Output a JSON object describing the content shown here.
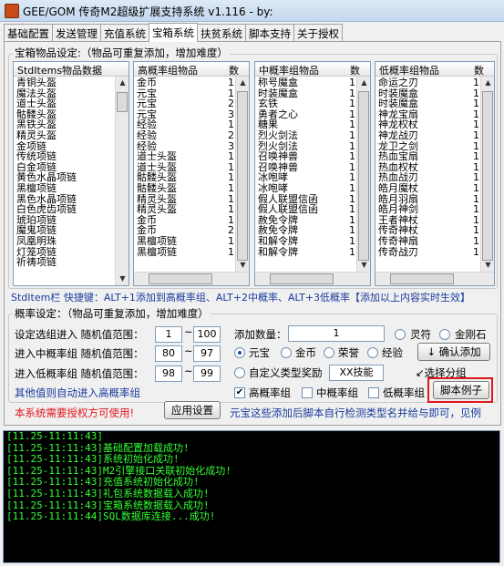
{
  "window": {
    "title": "GEE/GOM 传奇M2超级扩展支持系统 v1.116 - by:"
  },
  "tabs": [
    "基础配置",
    "发送管理",
    "充值系统",
    "宝箱系统",
    "扶贫系统",
    "脚本支持",
    "关于授权"
  ],
  "active_tab": "宝箱系统",
  "chest_group": {
    "title": "宝箱物品设定:（物品可重复添加，增加难度）"
  },
  "stditems": {
    "header": "StdItems物品数据",
    "rows": [
      "青铜头盔",
      "魔法头盔",
      "道士头盔",
      "骷髅头盔",
      "黑铁头盔",
      "精灵头盔",
      "金项链",
      "传统项链",
      "白金项链",
      "黄色水晶项链",
      "黑檀项链",
      "黑色水晶项链",
      "白色虎齿项链",
      "琥珀项链",
      "魔鬼项链",
      "凤凰明珠",
      "灯笼项链",
      "祈祷项链"
    ]
  },
  "high_list": {
    "header": "高概率组物品",
    "header2": "数",
    "rows": [
      [
        "金币",
        "1"
      ],
      [
        "元宝",
        "1"
      ],
      [
        "元宝",
        "2"
      ],
      [
        "元宝",
        "3"
      ],
      [
        "经验",
        "1"
      ],
      [
        "经验",
        "2"
      ],
      [
        "经验",
        "3"
      ],
      [
        "道士头盔",
        "1"
      ],
      [
        "道士头盔",
        "1"
      ],
      [
        "骷髅头盔",
        "1"
      ],
      [
        "骷髅头盔",
        "1"
      ],
      [
        "精灵头盔",
        "1"
      ],
      [
        "精灵头盔",
        "1"
      ],
      [
        "金币",
        "1"
      ],
      [
        "金币",
        "2"
      ],
      [
        "黑檀项链",
        "1"
      ],
      [
        "黑檀项链",
        "1"
      ]
    ]
  },
  "mid_list": {
    "header": "中概率组物品",
    "header2": "数",
    "rows": [
      [
        "称号魔盒",
        "1"
      ],
      [
        "时装魔盒",
        "1"
      ],
      [
        "玄铁",
        "1"
      ],
      [
        "勇者之心",
        "1"
      ],
      [
        "糖果",
        "1"
      ],
      [
        "烈火剑法",
        "1"
      ],
      [
        "烈火剑法",
        "1"
      ],
      [
        "召唤神兽",
        "1"
      ],
      [
        "召唤神兽",
        "1"
      ],
      [
        "冰咆哮",
        "1"
      ],
      [
        "冰咆哮",
        "1"
      ],
      [
        "假人联盟信函",
        "1"
      ],
      [
        "假人联盟信函",
        "1"
      ],
      [
        "赦免令牌",
        "1"
      ],
      [
        "赦免令牌",
        "1"
      ],
      [
        "和解令牌",
        "1"
      ],
      [
        "和解令牌",
        "1"
      ]
    ]
  },
  "low_list": {
    "header": "低概率组物品",
    "header2": "数",
    "rows": [
      [
        "命运之刃",
        "1"
      ],
      [
        "时装魔盒",
        "1"
      ],
      [
        "时装魔盒",
        "1"
      ],
      [
        "神龙宝扇",
        "1"
      ],
      [
        "神龙权杖",
        "1"
      ],
      [
        "神龙战刃",
        "1"
      ],
      [
        "龙卫之剑",
        "1"
      ],
      [
        "热血宝扇",
        "1"
      ],
      [
        "热血权杖",
        "1"
      ],
      [
        "热血战刃",
        "1"
      ],
      [
        "皓月魔杖",
        "1"
      ],
      [
        "皓月羽扇",
        "1"
      ],
      [
        "皓月神剑",
        "1"
      ],
      [
        "王者神杖",
        "1"
      ],
      [
        "传奇神杖",
        "1"
      ],
      [
        "传奇神扇",
        "1"
      ],
      [
        "传奇战刃",
        "1"
      ]
    ]
  },
  "hint": "StdItem栏 快捷键：ALT+1添加到高概率组、ALT+2中概率、ALT+3低概率【添加以上内容实时生效】",
  "prob_group": {
    "title": "概率设定：（物品可重复添加，增加难度）",
    "high_label": "设定选组进入  随机值范围：",
    "high_from": "1",
    "high_to": "100",
    "mid_label": "进入中概率组  随机值范围：",
    "mid_from": "80",
    "mid_to": "97",
    "low_label": "进入低概率组  随机值范围：",
    "low_from": "98",
    "low_to": "99",
    "tilde": "~",
    "other_label": "其他值则自动进入高概率组"
  },
  "add_panel": {
    "qty_label": "添加数量：",
    "qty_value": "1",
    "radio_lingfu": "灵符",
    "radio_jingangshi": "金刚石",
    "radio_yuanbao": "元宝",
    "radio_jinbi": "金币",
    "radio_rongyu": "荣誉",
    "radio_jingyan": "经验",
    "confirm_button": "↓ 确认添加",
    "custom_label": "自定义类型奖励",
    "custom_value": "XX技能",
    "select_group": "↙选择分组",
    "chk_high": "高概率组",
    "chk_mid": "中概率组",
    "chk_low": "低概率组",
    "chk_high_checked": true,
    "chk_mid_checked": false,
    "chk_low_checked": false,
    "script_button": "脚本例子"
  },
  "footer": {
    "auth_warning": "本系统需要授权方可使用!",
    "apply_button": "应用设置",
    "info": "元宝这些添加后脚本自行检测类型名并给与即可，见例"
  },
  "colors": {
    "auth_red": "#e0161b",
    "info_blue": "#1a3a9c",
    "log_green": "#33ff33"
  },
  "log_lines": [
    "[11.25-11:11:43]",
    "[11.25-11:11:43]基础配置加载成功!",
    "[11.25-11:11:43]系统初始化成功!",
    "[11.25-11:11:43]M2引擎接口关联初始化成功!",
    "[11.25-11:11:43]充值系统初始化成功!",
    "[11.25-11:11:43]礼包系统数据载入成功!",
    "[11.25-11:11:43]宝箱系统数据载入成功!",
    "[11.25-11:11:44]SQL数据库连接...成功!"
  ]
}
